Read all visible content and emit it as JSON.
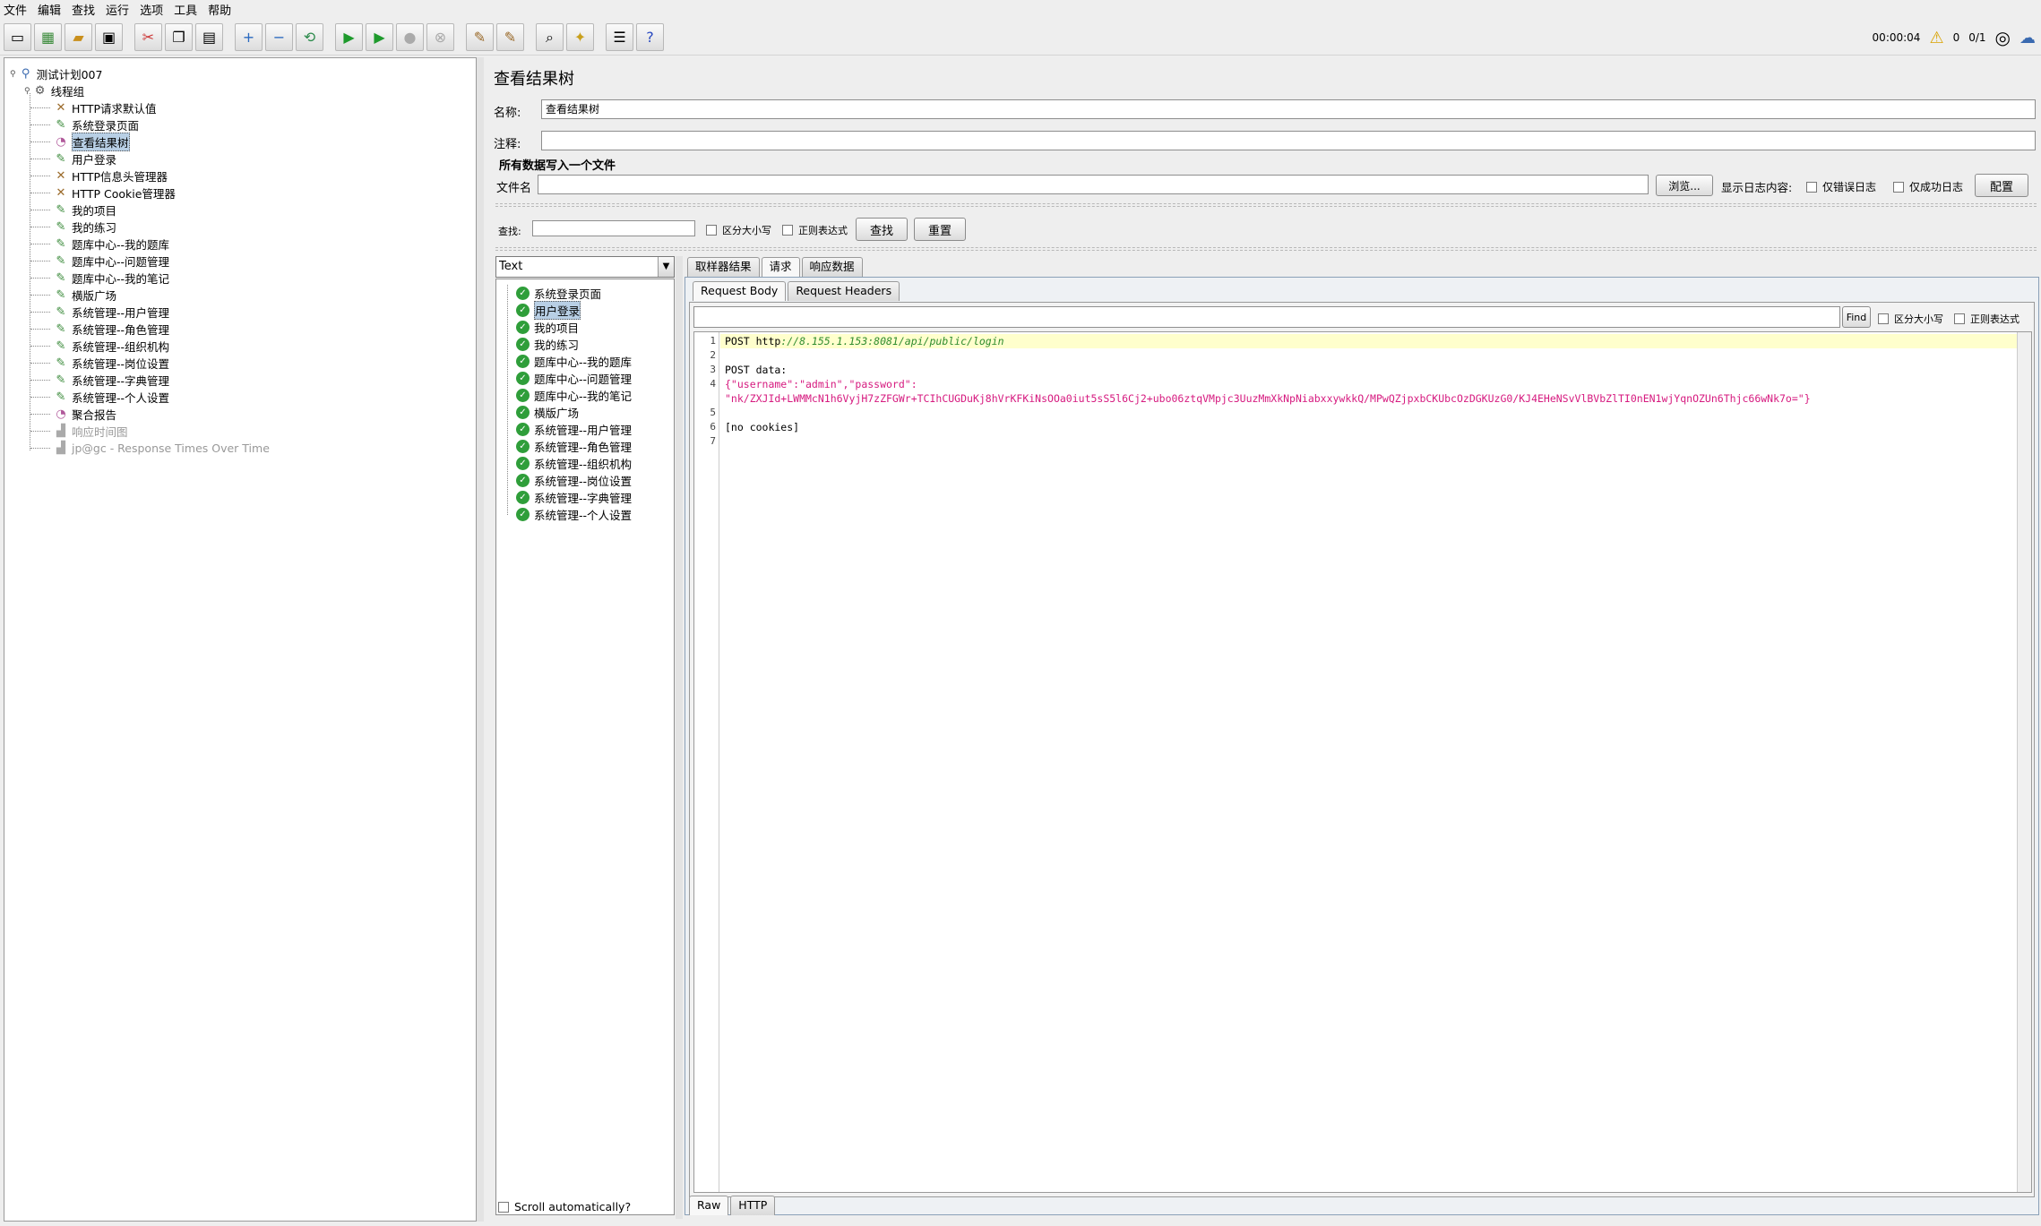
{
  "menu": [
    "文件",
    "编辑",
    "查找",
    "运行",
    "选项",
    "工具",
    "帮助"
  ],
  "toolbar_status": {
    "timer": "00:00:04",
    "warnings": "0",
    "threads": "0/1"
  },
  "tree": [
    {
      "label": "测试计划007",
      "icon": "testplan-icon",
      "level": 0
    },
    {
      "label": "线程组",
      "icon": "thread-group-icon",
      "level": 1
    },
    {
      "label": "HTTP请求默认值",
      "icon": "config-wrench-icon",
      "level": 2
    },
    {
      "label": "系统登录页面",
      "icon": "sampler-pencil-icon",
      "level": 2
    },
    {
      "label": "查看结果树",
      "icon": "listener-chart-icon",
      "level": 2,
      "selected": true
    },
    {
      "label": "用户登录",
      "icon": "sampler-pencil-icon",
      "level": 2
    },
    {
      "label": "HTTP信息头管理器",
      "icon": "config-wrench-icon",
      "level": 2
    },
    {
      "label": "HTTP Cookie管理器",
      "icon": "config-wrench-icon",
      "level": 2
    },
    {
      "label": "我的项目",
      "icon": "sampler-pencil-icon",
      "level": 2
    },
    {
      "label": "我的练习",
      "icon": "sampler-pencil-icon",
      "level": 2
    },
    {
      "label": "题库中心--我的题库",
      "icon": "sampler-pencil-icon",
      "level": 2
    },
    {
      "label": "题库中心--问题管理",
      "icon": "sampler-pencil-icon",
      "level": 2
    },
    {
      "label": "题库中心--我的笔记",
      "icon": "sampler-pencil-icon",
      "level": 2
    },
    {
      "label": "横版广场",
      "icon": "sampler-pencil-icon",
      "level": 2
    },
    {
      "label": "系统管理--用户管理",
      "icon": "sampler-pencil-icon",
      "level": 2
    },
    {
      "label": "系统管理--角色管理",
      "icon": "sampler-pencil-icon",
      "level": 2
    },
    {
      "label": "系统管理--组织机构",
      "icon": "sampler-pencil-icon",
      "level": 2
    },
    {
      "label": "系统管理--岗位设置",
      "icon": "sampler-pencil-icon",
      "level": 2
    },
    {
      "label": "系统管理--字典管理",
      "icon": "sampler-pencil-icon",
      "level": 2
    },
    {
      "label": "系统管理--个人设置",
      "icon": "sampler-pencil-icon",
      "level": 2
    },
    {
      "label": "聚合报告",
      "icon": "listener-chart-icon",
      "level": 2
    },
    {
      "label": "响应时间图",
      "icon": "graph-icon",
      "level": 2,
      "disabled": true
    },
    {
      "label": "jp@gc - Response Times Over Time",
      "icon": "graph-icon",
      "level": 2,
      "disabled": true
    }
  ],
  "panel": {
    "title": "查看结果树",
    "name_label": "名称:",
    "name_value": "查看结果树",
    "comment_label": "注释:",
    "comment_value": "",
    "file_section": "所有数据写入一个文件",
    "filename_label": "文件名",
    "filename_value": "",
    "browse_button": "浏览...",
    "log_label": "显示日志内容:",
    "errors_only": "仅错误日志",
    "success_only": "仅成功日志",
    "configure_button": "配置"
  },
  "search": {
    "label": "查找:",
    "value": "",
    "case_sensitive": "区分大小写",
    "regex": "正则表达式",
    "find_button": "查找",
    "reset_button": "重置"
  },
  "renderer": "Text",
  "results": [
    {
      "label": "系统登录页面"
    },
    {
      "label": "用户登录",
      "selected": true
    },
    {
      "label": "我的项目"
    },
    {
      "label": "我的练习"
    },
    {
      "label": "题库中心--我的题库"
    },
    {
      "label": "题库中心--问题管理"
    },
    {
      "label": "题库中心--我的笔记"
    },
    {
      "label": "横版广场"
    },
    {
      "label": "系统管理--用户管理"
    },
    {
      "label": "系统管理--角色管理"
    },
    {
      "label": "系统管理--组织机构"
    },
    {
      "label": "系统管理--岗位设置"
    },
    {
      "label": "系统管理--字典管理"
    },
    {
      "label": "系统管理--个人设置"
    }
  ],
  "scroll_auto": "Scroll automatically?",
  "result_tabs": [
    "取样器结果",
    "请求",
    "响应数据"
  ],
  "active_result_tab": "请求",
  "request_tabs": [
    "Request Body",
    "Request Headers"
  ],
  "active_request_tab": "Request Body",
  "editor_search": {
    "value": "",
    "find_button": "Find",
    "case_sensitive": "区分大小写",
    "regex": "正则表达式"
  },
  "code_lines": [
    {
      "n": "1",
      "text": "POST http://8.155.1.153:8081/api/public/login"
    },
    {
      "n": "2",
      "text": ""
    },
    {
      "n": "3",
      "text": "POST data:"
    },
    {
      "n": "4",
      "text": "{\"username\":\"admin\",\"password\":"
    },
    {
      "n": "",
      "text": "\"nk/ZXJId+LWMMcN1h6VyjH7zZFGWr+TCIhCUGDuKj8hVrKFKiNsOOa0iut5sS5l6Cj2+ubo06ztqVMpjc3UuzMmXkNpNiabxxywkkQ/MPwQZjpxbCKUbcOzDGKUzG0/KJ4EHeNSvVlBVbZlTI0nEN1wjYqnOZUn6Thjc66wNk7o=\"}"
    },
    {
      "n": "5",
      "text": ""
    },
    {
      "n": "6",
      "text": "[no cookies]"
    },
    {
      "n": "7",
      "text": ""
    }
  ],
  "bottom_tabs": [
    "Raw",
    "HTTP"
  ],
  "colors": {
    "url": "#2e8b2e",
    "json": "#d61a7f",
    "highlight": "#ffffcc",
    "selection": "#b8cfe5"
  }
}
